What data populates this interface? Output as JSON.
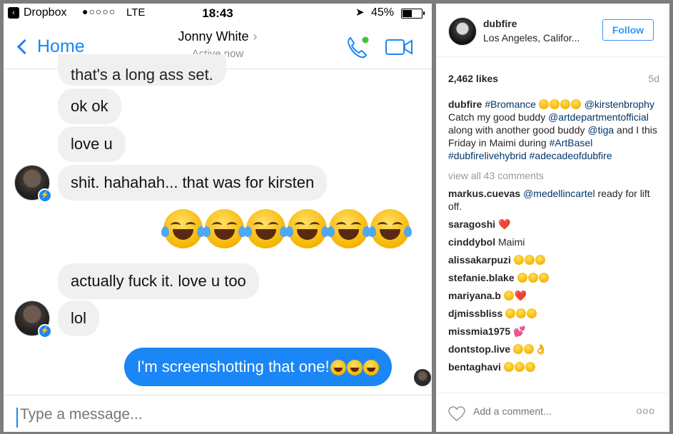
{
  "status_bar": {
    "back_app": "Dropbox",
    "signal": "●○○○○",
    "network": "LTE",
    "time": "18:43",
    "battery": "45%",
    "battery_level": 0.45
  },
  "nav": {
    "back_label": "Home",
    "contact_name": "Jonny White",
    "contact_status": "Active now"
  },
  "messages": {
    "partial_top": "that's a long ass set.",
    "m1": "ok ok",
    "m2": "love u",
    "m3": "shit. hahahah... that was for kirsten",
    "m4": "actually fuck it. love u too",
    "m5": "lol",
    "m6": "I'm screenshotting that one!"
  },
  "composer": {
    "placeholder": "Type a message..."
  },
  "instagram": {
    "username": "dubfire",
    "location": "Los Angeles, Califor...",
    "follow_label": "Follow",
    "likes": "2,462 likes",
    "age": "5d",
    "caption": {
      "user": "dubfire",
      "tag1": "#Bromance",
      "mention1": "@kirstenbrophy",
      "text1": " Catch my good buddy ",
      "mention2": "@artdepartmentofficial",
      "text2": " along with another good buddy ",
      "mention3": "@tiga",
      "text3": " and I this Friday in Maimi during ",
      "tag2": "#ArtBasel",
      "tag3": "#dubfirelivehybrid",
      "tag4": "#adecadeofdubfire"
    },
    "view_all": "view all 43 comments",
    "comments": [
      {
        "user": "markus.cuevas",
        "mention": "@medellincartel",
        "text": " ready for lift off."
      },
      {
        "user": "saragoshi",
        "text": ""
      },
      {
        "user": "cinddybol",
        "text": "Maimi"
      },
      {
        "user": "alissakarpuzi",
        "text": ""
      },
      {
        "user": "stefanie.blake",
        "text": ""
      },
      {
        "user": "mariyana.b",
        "text": ""
      },
      {
        "user": "djmissbliss",
        "text": ""
      },
      {
        "user": "missmia1975",
        "text": ""
      },
      {
        "user": "dontstop.live",
        "text": ""
      },
      {
        "user": "bentaghavi",
        "text": ""
      }
    ],
    "add_comment_placeholder": "Add a comment...",
    "more": "ooo"
  },
  "colors": {
    "messenger_blue": "#1b86f5",
    "bubble_gray": "#f1f0f0",
    "instagram_link": "#003569",
    "follow_blue": "#3897f0"
  },
  "icons": [
    "back-badge-icon",
    "chevron-left-icon",
    "chevron-right-icon",
    "phone-icon",
    "video-camera-icon",
    "messenger-badge-icon",
    "laughing-crying-emoji-icon",
    "heart-emoji-icon",
    "heart-outline-icon",
    "more-options-icon",
    "location-arrow-icon",
    "battery-icon"
  ]
}
